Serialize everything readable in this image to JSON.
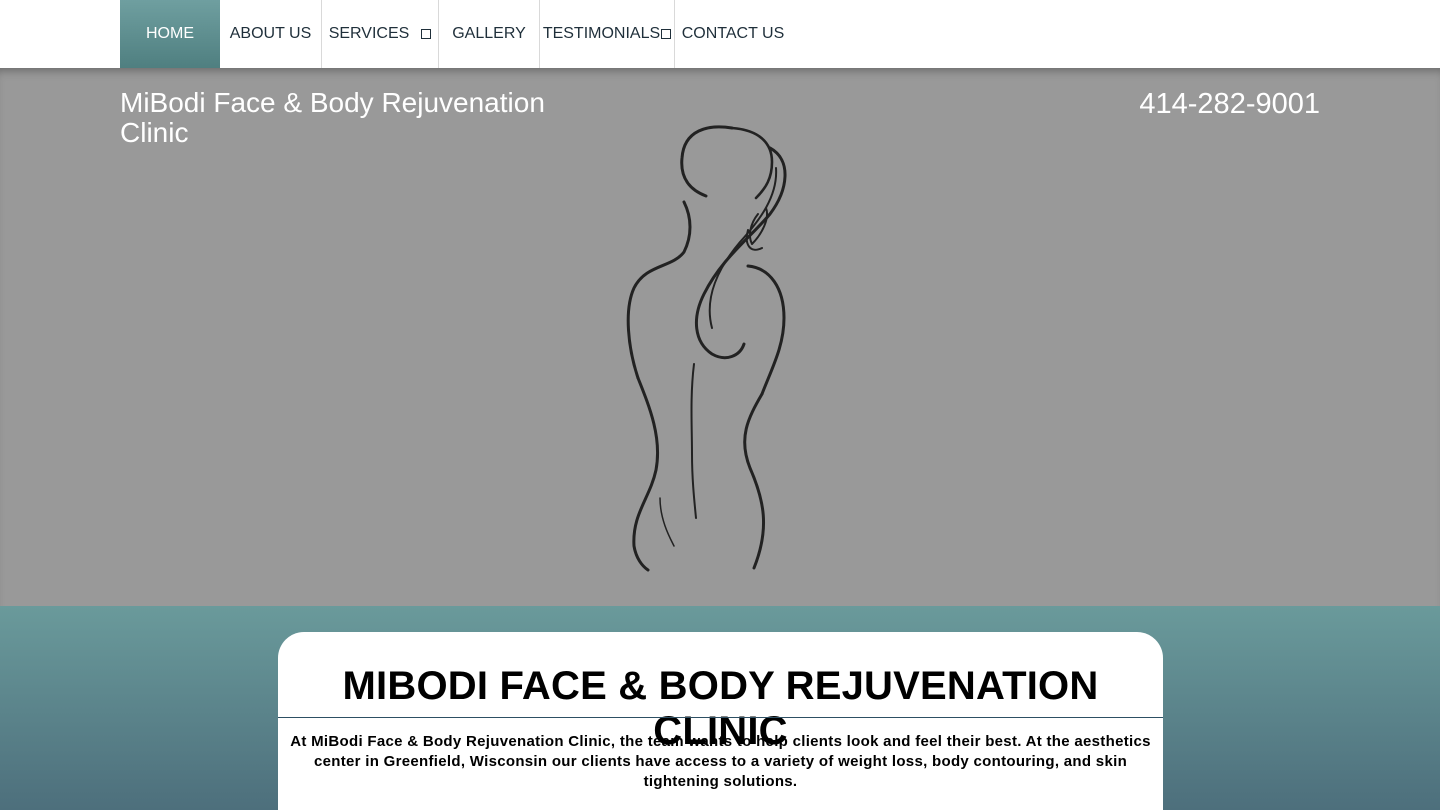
{
  "nav": {
    "items": [
      {
        "label": "HOME"
      },
      {
        "label": "ABOUT US"
      },
      {
        "label": "SERVICES"
      },
      {
        "label": "GALLERY"
      },
      {
        "label": "TESTIMONIALS"
      },
      {
        "label": "CONTACT US"
      }
    ]
  },
  "hero": {
    "site_title": "MiBodi Face & Body Rejuvenation Clinic",
    "phone": "414-282-9001",
    "image_icon": "woman-silhouette-drawing"
  },
  "main": {
    "heading": "MIBODI FACE & BODY REJUVENATION CLINIC",
    "intro": "At MiBodi Face & Body Rejuvenation Clinic, the team wants to help clients look and feel their best. At the aesthetics center in Greenfield, Wisconsin our clients have access to a variety of weight loss, body contouring, and skin tightening solutions."
  },
  "colors": {
    "accent": "#5f8f90",
    "hero_bg": "#999999",
    "band_bottom": "#4d6f7c"
  }
}
